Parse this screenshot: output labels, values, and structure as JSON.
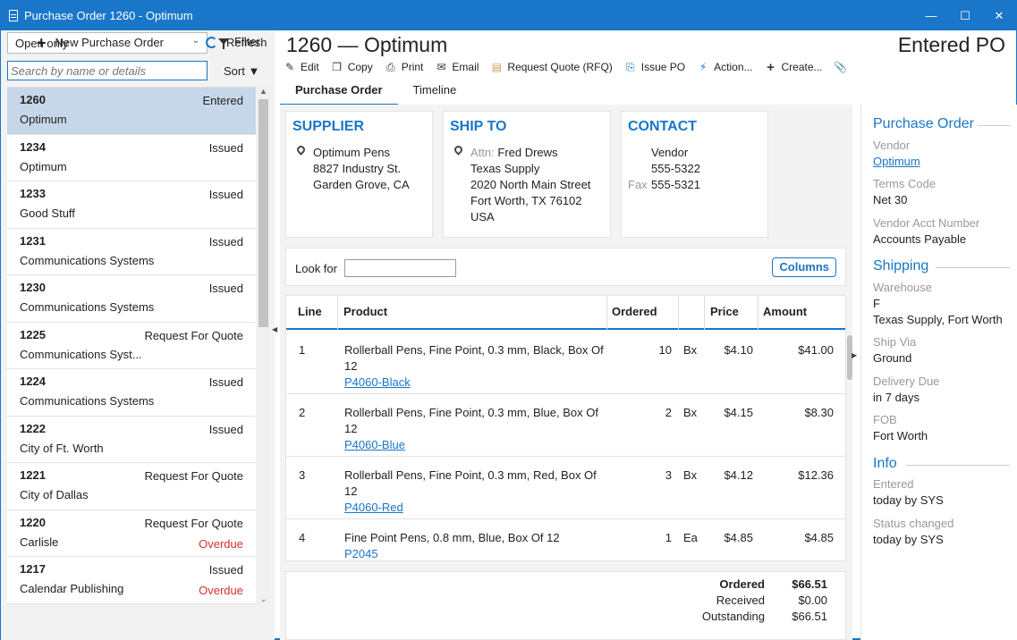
{
  "window": {
    "title": "Purchase Order 1260 - Optimum",
    "minimize": "—",
    "maximize": "☐",
    "close": "✕"
  },
  "left": {
    "filter_select": "Open only",
    "filter_label": "Filter",
    "search_placeholder": "Search by name or details",
    "sort_label": "Sort ▼",
    "items": [
      {
        "num": "1260",
        "status": "Entered",
        "name": "Optimum",
        "overdue": ""
      },
      {
        "num": "1234",
        "status": "Issued",
        "name": "Optimum",
        "overdue": ""
      },
      {
        "num": "1233",
        "status": "Issued",
        "name": "Good Stuff",
        "overdue": ""
      },
      {
        "num": "1231",
        "status": "Issued",
        "name": "Communications Systems",
        "overdue": ""
      },
      {
        "num": "1230",
        "status": "Issued",
        "name": "Communications Systems",
        "overdue": ""
      },
      {
        "num": "1225",
        "status": "Request For Quote",
        "name": "Communications Syst...",
        "overdue": ""
      },
      {
        "num": "1224",
        "status": "Issued",
        "name": "Communications Systems",
        "overdue": ""
      },
      {
        "num": "1222",
        "status": "Issued",
        "name": "City of Ft. Worth",
        "overdue": ""
      },
      {
        "num": "1221",
        "status": "Request For Quote",
        "name": "City of Dallas",
        "overdue": ""
      },
      {
        "num": "1220",
        "status": "Request For Quote",
        "name": "Carlisle",
        "overdue": "Overdue"
      },
      {
        "num": "1217",
        "status": "Issued",
        "name": "Calendar Publishing",
        "overdue": "Overdue"
      }
    ],
    "new_po_label": "New Purchase Order",
    "refresh_label": "Refresh"
  },
  "header": {
    "title": "1260 — Optimum",
    "status": "Entered PO",
    "toolbar": {
      "edit": "Edit",
      "copy": "Copy",
      "print": "Print",
      "email": "Email",
      "request_quote": "Request Quote (RFQ)",
      "issue_po": "Issue PO",
      "action": "Action...",
      "create": "Create..."
    },
    "tabs": {
      "purchase_order": "Purchase Order",
      "timeline": "Timeline"
    }
  },
  "supplier": {
    "heading": "SUPPLIER",
    "name": "Optimum Pens",
    "street": "8827 Industry St.",
    "city": "Garden Grove, CA"
  },
  "ship_to": {
    "heading": "SHIP TO",
    "attn_label": "Attn:",
    "attn": "Fred Drews",
    "company": "Texas Supply",
    "street": "2020 North Main Street",
    "city": "Fort Worth, TX  76102",
    "country": "USA"
  },
  "contact": {
    "heading": "CONTACT",
    "role": "Vendor",
    "phone": "555-5322",
    "fax_label": "Fax",
    "fax": "555-5321"
  },
  "lookfor": {
    "label": "Look for",
    "value": "",
    "columns_button": "Columns"
  },
  "grid": {
    "headers": {
      "line": "Line",
      "product": "Product",
      "ordered": "Ordered",
      "price": "Price",
      "amount": "Amount"
    },
    "rows": [
      {
        "line": "1",
        "product": "Rollerball Pens, Fine Point, 0.3 mm, Black, Box Of 12",
        "code": "P4060-Black",
        "ordered": "10",
        "unit": "Bx",
        "price": "$4.10",
        "amount": "$41.00"
      },
      {
        "line": "2",
        "product": "Rollerball Pens, Fine Point, 0.3 mm, Blue, Box Of 12",
        "code": "P4060-Blue",
        "ordered": "2",
        "unit": "Bx",
        "price": "$4.15",
        "amount": "$8.30"
      },
      {
        "line": "3",
        "product": "Rollerball Pens, Fine Point, 0.3 mm, Red, Box Of 12",
        "code": "P4060-Red",
        "ordered": "3",
        "unit": "Bx",
        "price": "$4.12",
        "amount": "$12.36"
      },
      {
        "line": "4",
        "product": "Fine Point Pens, 0.8 mm, Blue, Box Of 12",
        "code": "P2045",
        "ordered": "1",
        "unit": "Ea",
        "price": "$4.85",
        "amount": "$4.85"
      }
    ]
  },
  "totals": {
    "ordered_label": "Ordered",
    "ordered": "$66.51",
    "received_label": "Received",
    "received": "$0.00",
    "outstanding_label": "Outstanding",
    "outstanding": "$66.51"
  },
  "right": {
    "po_heading": "Purchase Order",
    "vendor_label": "Vendor",
    "vendor": "Optimum",
    "terms_label": "Terms Code",
    "terms": "Net 30",
    "acct_label": "Vendor Acct Number",
    "acct": "Accounts Payable",
    "shipping_heading": "Shipping",
    "warehouse_label": "Warehouse",
    "warehouse_code": "F",
    "warehouse": "Texas Supply, Fort Worth",
    "shipvia_label": "Ship Via",
    "shipvia": "Ground",
    "due_label": "Delivery Due",
    "due": "in 7 days",
    "fob_label": "FOB",
    "fob": "Fort Worth",
    "info_heading": "Info",
    "entered_label": "Entered",
    "entered": "today by SYS",
    "status_changed_label": "Status changed",
    "status_changed": "today by SYS"
  }
}
